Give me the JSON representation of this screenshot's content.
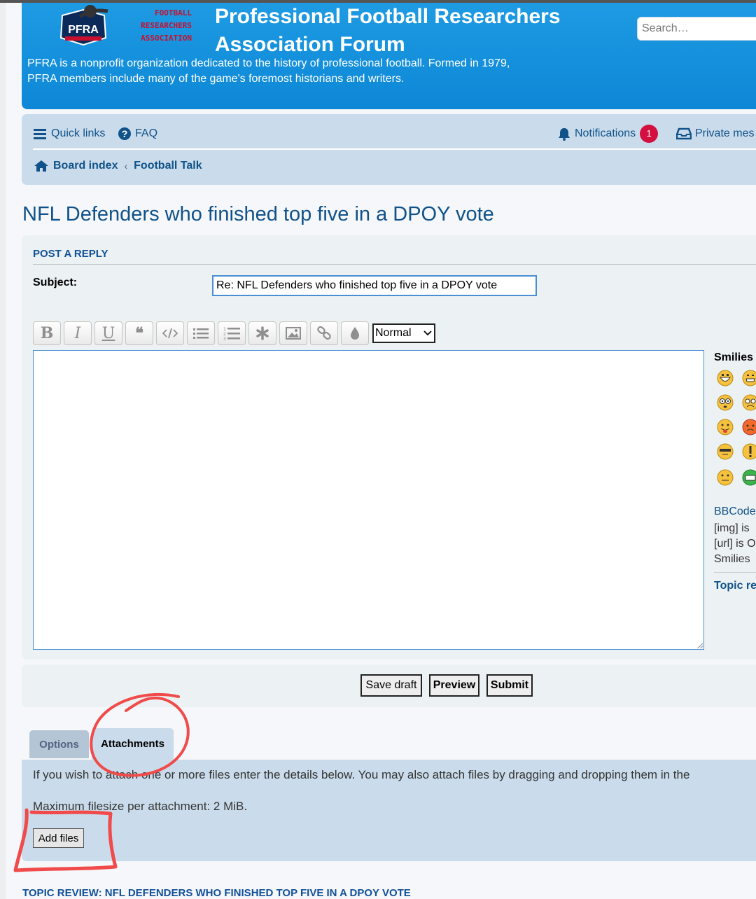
{
  "header": {
    "logo_text": "PFRA",
    "logo_lines": [
      "FOOTBALL",
      "RESEARCHERS",
      "ASSOCIATION"
    ],
    "title_line1": "Professional Football Researchers",
    "title_line2": "Association Forum",
    "description_line1": "PFRA is a nonprofit organization dedicated to the history of professional football. Formed in 1979,",
    "description_line2": "PFRA members include many of the game's foremost historians and writers.",
    "search_placeholder": "Search…"
  },
  "nav": {
    "quick_links": "Quick links",
    "faq": "FAQ",
    "notifications": "Notifications",
    "notifications_count": "1",
    "private_messages": "Private mes",
    "breadcrumbs": [
      "Board index",
      "Football Talk"
    ],
    "breadcrumb_sep": "‹"
  },
  "topic_title": "NFL Defenders who finished top five in a DPOY vote",
  "post": {
    "heading": "POST A REPLY",
    "subject_label": "Subject:",
    "subject_value": "Re: NFL Defenders who finished top five in a DPOY vote",
    "toolbar": {
      "bold": "B",
      "italic": "I",
      "underline": "U",
      "quote": "❝",
      "font_size_selected": "Normal"
    },
    "smilies_title": "Smilies",
    "bbcode_link": "BBCode",
    "img_text": "[img] is",
    "url_text": "[url] is O",
    "smilies_text": "Smilies",
    "topic_review_link": "Topic re"
  },
  "actions": {
    "save_draft": "Save draft",
    "preview": "Preview",
    "submit": "Submit"
  },
  "tabs": {
    "options": "Options",
    "attachments": "Attachments"
  },
  "attachments": {
    "info": "If you wish to attach one or more files enter the details below. You may also attach files by dragging and dropping them in the",
    "max_size": "Maximum filesize per attachment: 2 MiB.",
    "add_files": "Add files"
  },
  "topic_review_heading": "TOPIC REVIEW: NFL DEFENDERS WHO FINISHED TOP FIVE IN A DPOY VOTE",
  "colors": {
    "header_blue": "#12a0e8",
    "link_blue": "#105289",
    "panel_bg": "#cadceb",
    "annotation_red": "#f04a4a",
    "badge_red": "#d31141"
  }
}
